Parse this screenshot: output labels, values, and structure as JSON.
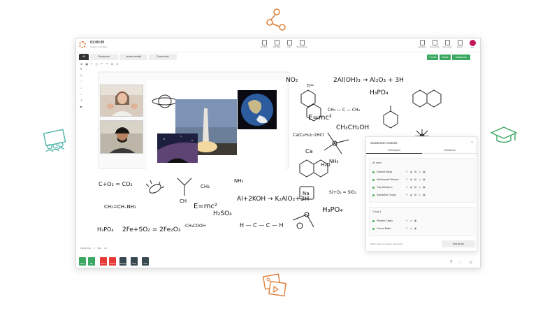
{
  "topbar": {
    "timer": "01:00:00",
    "timer_sub": "Session recording",
    "tools": [
      {
        "label": "Full Pres",
        "icon": "present-icon"
      },
      {
        "label": "Add Slide",
        "icon": "slide-icon"
      },
      {
        "label": "Files",
        "icon": "file-icon"
      },
      {
        "label": "Screen Share",
        "icon": "screen-icon"
      }
    ],
    "right_tools": [
      {
        "label": "Indicators",
        "icon": "indicator-icon"
      },
      {
        "label": "Screenshot",
        "icon": "camera-icon"
      },
      {
        "label": "Auto Layout",
        "icon": "layout-icon"
      },
      {
        "label": "Record",
        "icon": "record-icon"
      },
      {
        "label": "Exit",
        "icon": "exit-icon"
      }
    ]
  },
  "tabs": [
    {
      "label": "All",
      "active": true
    },
    {
      "label": "Breakouts",
      "active": false
    },
    {
      "label": "Lesson details",
      "active": false
    },
    {
      "label": "Downloads",
      "active": false
    }
  ],
  "action_buttons": [
    "+ Invite",
    "Share",
    "Classroom"
  ],
  "whiteboard": {
    "formulas": {
      "f_no2": "NO₂",
      "f_ti": "Ti²²",
      "f_aloh": "2Al(OH)₃ → Al₂O₃ + 3H",
      "f_h3po4a": "H₃PO₄",
      "f_emc2a": "E=mc²",
      "f_ch3": "CH₃ — C — CH₃",
      "f_ch3ch2": "CH₃CH₂OH",
      "f_cacl": "Ca(C₂H₅)₂·2HCl",
      "f_ca": "Ca",
      "f_co2": "C+O₂ = CO₂",
      "f_chrchnh2": "CH₂=CH–NH₂",
      "f_ch": "CH",
      "f_ch2": "CH₂",
      "f_emc2b": "E=mc²",
      "f_nh2": "NH₂",
      "f_h2so4": "H₂SO₄",
      "f_al2koh": "Al+2KOH → K₂AlO₂+3H",
      "f_na": "Na",
      "f_sio2": "Si+O₂ = SiO₂",
      "f_h3po4b": "H₃PO₄",
      "f_h3po4c": "H₃PO₄",
      "f_feso": "2Fe+SO₂ = 2Fe₂O₃",
      "f_ch3cooh": "CH₃COOH",
      "f_hch": "H — C — C — H",
      "f_nh3": "NH₃",
      "f_h2o": "H₂O"
    }
  },
  "pencil": {
    "label": "Pencil Size",
    "value": "2",
    "size_label": "Size",
    "size_value": "24"
  },
  "bottom_buttons": [
    {
      "label": "Video",
      "color": "#3aa860",
      "icon": "video-icon"
    },
    {
      "label": "Mic",
      "color": "#3aa860",
      "icon": "mic-icon"
    },
    {
      "label": "Annot",
      "color": "#e53935",
      "icon": "pen-icon"
    },
    {
      "label": "Screen",
      "color": "#e53935",
      "icon": "screen-icon"
    },
    {
      "label": "Settings",
      "color": "#37474f",
      "icon": "gear-icon"
    },
    {
      "label": "Hand",
      "color": "#37474f",
      "icon": "hand-icon"
    },
    {
      "label": "Chat",
      "color": "#37474f",
      "icon": "chat-icon"
    }
  ],
  "panel": {
    "title": "Classroom controls",
    "tabs": [
      "Participants",
      "Breakouts"
    ],
    "group_all": "All users",
    "participants": [
      {
        "name": "Edward Hardy"
      },
      {
        "name": "Mohammed Gilmore"
      },
      {
        "name": "Troy Mcmaron"
      },
      {
        "name": "Samantha Thorpe"
      }
    ],
    "group1": "Group 1",
    "group_members": [
      {
        "name": "Phoebe Castro"
      },
      {
        "name": "Yomna Blake"
      }
    ],
    "add_placeholder": "Add a name to create a new group",
    "add_button": "Add group"
  },
  "colors": {
    "accent_orange": "#e0803a",
    "accent_green": "#3aa860",
    "icon_teal": "#4ab3a8"
  }
}
